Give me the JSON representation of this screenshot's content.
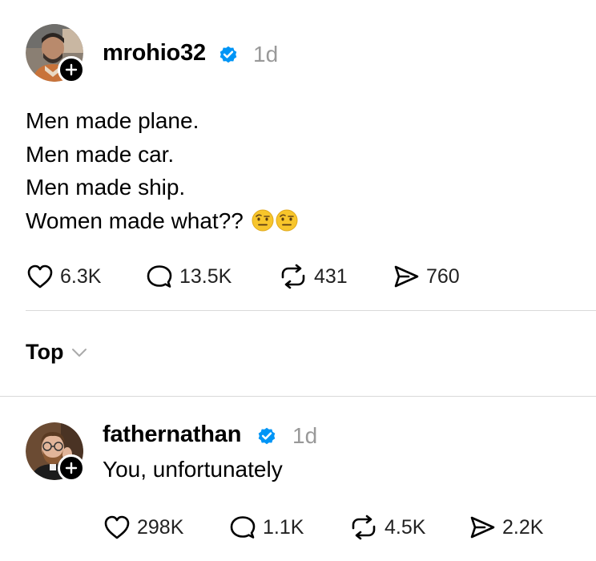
{
  "post": {
    "author": {
      "username": "mrohio32",
      "verified": true,
      "avatar_icon": "profile-photo",
      "follow_icon": "plus-icon"
    },
    "timestamp": "1d",
    "lines": [
      "Men made plane.",
      "Men made car.",
      "Men made ship.",
      "Women made what??"
    ],
    "emojis": [
      "face-with-raised-eyebrow",
      "face-with-raised-eyebrow"
    ],
    "actions": {
      "likes": "6.3K",
      "replies": "13.5K",
      "reposts": "431",
      "shares": "760"
    }
  },
  "sort": {
    "label": "Top",
    "icon": "chevron-down-icon"
  },
  "reply": {
    "author": {
      "username": "fathernathan",
      "verified": true,
      "avatar_icon": "profile-photo",
      "follow_icon": "plus-icon"
    },
    "timestamp": "1d",
    "text": "You, unfortunately",
    "actions": {
      "likes": "298K",
      "replies": "1.1K",
      "reposts": "4.5K",
      "shares": "2.2K"
    }
  },
  "colors": {
    "verified": "#0095f6",
    "timestamp": "#999999",
    "divider": "#d9d9d9",
    "text": "#000000"
  }
}
